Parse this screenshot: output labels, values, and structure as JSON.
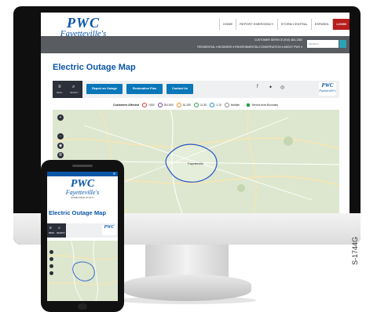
{
  "logo": {
    "mark": "PWC",
    "city": "Fayetteville's",
    "tagline": "HOMETOWN UTILITY"
  },
  "topnav": [
    "HOME",
    "REPORT EMERGENCY",
    "STORM CENTRAL",
    "ESPAÑOL",
    "LOGIN"
  ],
  "customer_service": "CUSTOMER SERVICE (910) 483-1382",
  "subnav": "RESIDENTIAL ▾   BUSINESS ▾   ENVIRONMENTAL/CONSERVATION ▾   ABOUT PWC ▾",
  "search_placeholder": "SEARCH...",
  "page_title": "Electric Outage Map",
  "toolbar": {
    "menu_label": "MENU",
    "search_label": "SEARCH",
    "report_button": "Report an Outage",
    "restoration_button": "Restoration Plan",
    "contact_button": "Contact Us"
  },
  "legend": {
    "title": "Customers Affected",
    "items": [
      {
        "label": ">500",
        "color": "#d93a2b"
      },
      {
        "label": "251-500",
        "color": "#7b3fa0"
      },
      {
        "label": "51-250",
        "color": "#e88a1a"
      },
      {
        "label": "11-50",
        "color": "#2e9e4a"
      },
      {
        "label": "1-10",
        "color": "#1e88c8"
      },
      {
        "label": "Multiple",
        "color": "#888888"
      }
    ],
    "boundary_label": "Service Area Boundary",
    "boundary_color": "#2e9e4a"
  },
  "map": {
    "city_label": "Fayetteville",
    "controls": [
      "+",
      "zoom-out",
      "locate",
      "layers"
    ]
  },
  "phone": {
    "title": "Electric Outage Map",
    "menu_label": "MENU",
    "search_label": "SEARCH"
  },
  "side_text": "S-1744G",
  "colors": {
    "brand_blue": "#0a56a6",
    "button_blue": "#0a77b8",
    "login_red": "#b71c1c"
  }
}
